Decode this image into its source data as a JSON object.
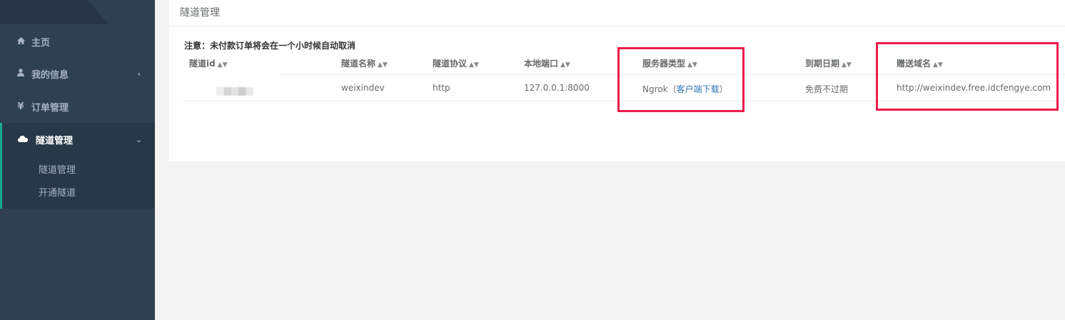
{
  "sidebar": {
    "items": [
      {
        "label": "主页",
        "icon": "home-icon"
      },
      {
        "label": "我的信息",
        "icon": "user-icon"
      },
      {
        "label": "订单管理",
        "icon": "yen-icon"
      },
      {
        "label": "隧道管理",
        "icon": "cloud-icon"
      }
    ],
    "subitems": [
      "隧道管理",
      "开通隧道"
    ]
  },
  "main": {
    "title": "隧道管理",
    "notice": "注意：未付款订单将会在一个小时候自动取消",
    "table": {
      "columns": [
        "隧道id",
        "隧道名称",
        "隧道协议",
        "本地端口",
        "服务器类型",
        "到期日期",
        "赠送域名"
      ],
      "rows": [
        {
          "name": "weixindev",
          "protocol": "http",
          "local_port": "127.0.0.1:8000",
          "server_type": "Ngrok（",
          "client_link": "客户端下载",
          "server_type_end": "）",
          "expiry": "免费不过期",
          "domain": "http://weixindev.free.idcfengye.com"
        }
      ]
    }
  },
  "colors": {
    "sidebar_bg": "#2f4050",
    "highlight_box": "#ee1b4d",
    "link": "#337ab7",
    "active_border": "#19aa8d"
  }
}
